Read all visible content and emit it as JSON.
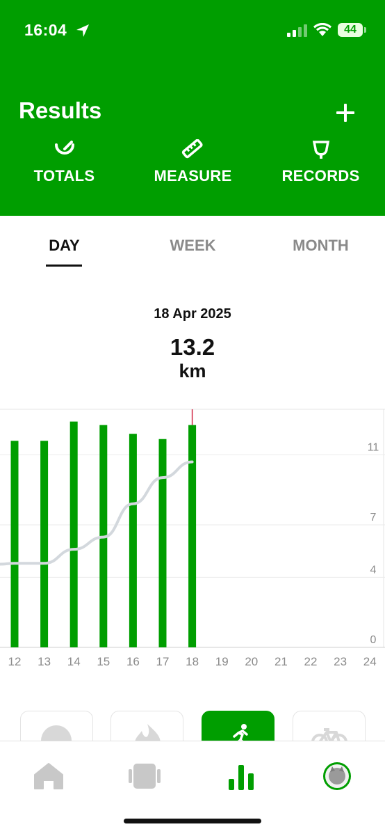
{
  "status_bar": {
    "time": "16:04",
    "battery": "44"
  },
  "header": {
    "title": "Results",
    "segments": [
      {
        "label": "TOTALS",
        "icon": "gauge-icon"
      },
      {
        "label": "MEASURE",
        "icon": "ruler-icon"
      },
      {
        "label": "RECORDS",
        "icon": "trophy-icon"
      }
    ]
  },
  "period_tabs": {
    "day": "DAY",
    "week": "WEEK",
    "month": "MONTH",
    "active": "day"
  },
  "summary": {
    "date": "18 Apr 2025",
    "value": "13.2",
    "unit": "km"
  },
  "chart_data": {
    "type": "bar",
    "categories": [
      "12",
      "13",
      "14",
      "15",
      "16",
      "17",
      "18",
      "19",
      "20",
      "21",
      "22",
      "23",
      "24"
    ],
    "series": [
      {
        "values": [
          11.8,
          11.8,
          12.9,
          12.7,
          12.2,
          11.9,
          12.7,
          null,
          null,
          null,
          null,
          null,
          null
        ]
      },
      {
        "values": [
          4.8,
          4.8,
          5.6,
          6.3,
          8.2,
          9.7,
          10.6,
          null,
          null,
          null,
          null,
          null,
          null
        ]
      }
    ],
    "bar_color": "#009e00",
    "trend_color": "#d3d8dd",
    "marker_color": "#d0213f",
    "selected_category": "18",
    "y_ticks": [
      0,
      4,
      7,
      11
    ],
    "ylim": [
      0,
      13.6
    ],
    "grid": true
  },
  "activity_filters": [
    {
      "name": "moon-icon",
      "active": false
    },
    {
      "name": "flame-icon",
      "active": false
    },
    {
      "name": "running-icon",
      "active": true
    },
    {
      "name": "bicycle-icon",
      "active": false
    }
  ],
  "tab_bar": {
    "items": [
      "home-icon",
      "device-icon",
      "results-icon",
      "profile-avatar"
    ],
    "active": "results-icon"
  },
  "colors": {
    "brand_green": "#009e00",
    "inactive": "#8a8a8a"
  }
}
